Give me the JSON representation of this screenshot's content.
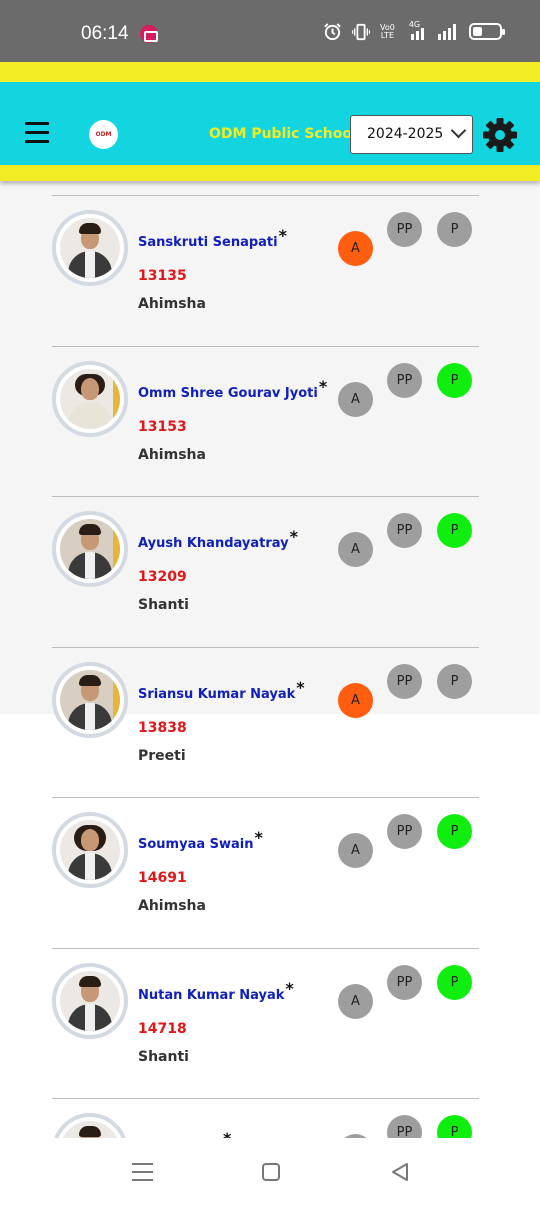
{
  "status_bar": {
    "time": "06:14",
    "net_top": "Vo0",
    "net_bot": "LTE",
    "net_type": "4G"
  },
  "header": {
    "logo_text": "ODM",
    "school_name": "ODM Public School",
    "year": "2024-2025"
  },
  "colors": {
    "header": "#13d5e0",
    "band": "#f2ec24",
    "absent_marked": "#ff5e10",
    "present_marked": "#10ee10",
    "unmarked": "#9e9e9e"
  },
  "students": [
    {
      "name": "Sanskruti Senapati",
      "star": "*",
      "roll": "13135",
      "house": "Ahimsha",
      "a": "A",
      "pp": "PP",
      "p": "P",
      "a_state": "orange",
      "p_state": "grey"
    },
    {
      "name": "Omm Shree Gourav Jyoti",
      "star": "*",
      "roll": "13153",
      "house": "Ahimsha",
      "a": "A",
      "pp": "PP",
      "p": "P",
      "a_state": "grey",
      "p_state": "green"
    },
    {
      "name": "Ayush Khandayatray",
      "star": "*",
      "roll": "13209",
      "house": "Shanti",
      "a": "A",
      "pp": "PP",
      "p": "P",
      "a_state": "grey",
      "p_state": "green"
    },
    {
      "name": "Sriansu Kumar Nayak",
      "star": "*",
      "roll": "13838",
      "house": "Preeti",
      "a": "A",
      "pp": "PP",
      "p": "P",
      "a_state": "orange",
      "p_state": "grey"
    },
    {
      "name": "Soumyaa Swain",
      "star": "*",
      "roll": "14691",
      "house": "Ahimsha",
      "a": "A",
      "pp": "PP",
      "p": "P",
      "a_state": "grey",
      "p_state": "green"
    },
    {
      "name": "Nutan Kumar Nayak",
      "star": "*",
      "roll": "14718",
      "house": "Shanti",
      "a": "A",
      "pp": "PP",
      "p": "P",
      "a_state": "grey",
      "p_state": "green"
    },
    {
      "name": "",
      "star": "*",
      "roll": "",
      "house": "",
      "a": "",
      "pp": "PP",
      "p": "P",
      "a_state": "grey",
      "p_state": "green"
    }
  ]
}
